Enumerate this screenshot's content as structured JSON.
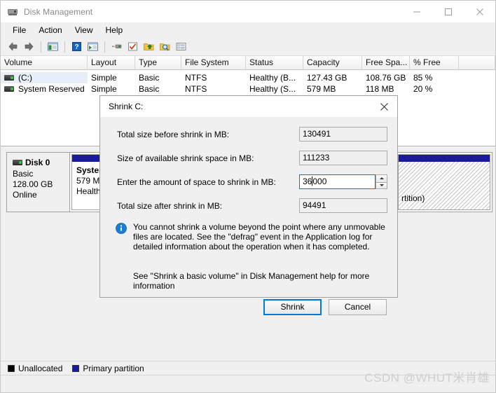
{
  "window": {
    "title": "Disk Management",
    "icon": "disk-drive-icon",
    "controls": {
      "minimize": "minimize-icon",
      "maximize": "maximize-icon",
      "close": "close-icon"
    }
  },
  "menu": {
    "items": [
      {
        "label": "File"
      },
      {
        "label": "Action"
      },
      {
        "label": "View"
      },
      {
        "label": "Help"
      }
    ]
  },
  "toolbar": {
    "buttons": [
      {
        "name": "back-arrow-icon"
      },
      {
        "name": "forward-arrow-icon"
      },
      {
        "name": "show-hide-console-tree-icon"
      },
      {
        "name": "help-question-icon"
      },
      {
        "name": "show-hide-action-pane-icon"
      },
      {
        "name": "properties-icon"
      },
      {
        "name": "rescan-disks-icon"
      },
      {
        "name": "export-list-icon"
      },
      {
        "name": "find-icon"
      },
      {
        "name": "details-view-icon"
      }
    ]
  },
  "volume_list": {
    "columns": [
      {
        "label": "Volume",
        "width": 124
      },
      {
        "label": "Layout",
        "width": 68
      },
      {
        "label": "Type",
        "width": 66
      },
      {
        "label": "File System",
        "width": 92
      },
      {
        "label": "Status",
        "width": 82
      },
      {
        "label": "Capacity",
        "width": 84
      },
      {
        "label": "Free Spa...",
        "width": 68
      },
      {
        "label": "% Free",
        "width": 70
      },
      {
        "label": "",
        "width": 54
      }
    ],
    "rows": [
      {
        "selected": true,
        "icon": "volume-drive-icon",
        "volume": "(C:)",
        "layout": "Simple",
        "type": "Basic",
        "file_system": "NTFS",
        "status": "Healthy (B...",
        "capacity": "127.43 GB",
        "free_space": "108.76 GB",
        "percent_free": "85 %"
      },
      {
        "selected": false,
        "icon": "volume-drive-icon",
        "volume": "System Reserved",
        "layout": "Simple",
        "type": "Basic",
        "file_system": "NTFS",
        "status": "Healthy (S...",
        "capacity": "579 MB",
        "free_space": "118 MB",
        "percent_free": "20 %"
      }
    ]
  },
  "disk_pane": {
    "disk": {
      "icon": "disk-drive-icon",
      "name": "Disk 0",
      "type": "Basic",
      "size": "128.00 GB",
      "status": "Online"
    },
    "partitions": [
      {
        "name_line": "System",
        "size_line": "579 MB",
        "status_line": "Healthy",
        "kind": "primary"
      },
      {
        "name_line": "",
        "size_line": "",
        "status_line": "",
        "kind": "primary"
      },
      {
        "name_line": "rtition)",
        "size_line": "",
        "status_line": "",
        "kind": "unallocated"
      }
    ]
  },
  "legend": {
    "items": [
      {
        "label": "Unallocated",
        "color": "#000000"
      },
      {
        "label": "Primary partition",
        "color": "#1a1a9c"
      }
    ]
  },
  "watermark": {
    "text": "CSDN @WHUT米肖雄"
  },
  "dialog": {
    "title": "Shrink C:",
    "close_icon": "close-icon",
    "fields": [
      {
        "label": "Total size before shrink in MB:",
        "value": "130491",
        "editable": false,
        "name": "total-size-before-shrink-field"
      },
      {
        "label": "Size of available shrink space in MB:",
        "value": "111233",
        "editable": false,
        "name": "available-shrink-space-field"
      },
      {
        "label": "Enter the amount of space to shrink in MB:",
        "value_before_caret": "36",
        "value_after_caret": "000",
        "value": "36000",
        "editable": true,
        "name": "shrink-amount-input"
      },
      {
        "label": "Total size after shrink in MB:",
        "value": "94491",
        "editable": false,
        "name": "total-size-after-shrink-field"
      }
    ],
    "info": {
      "icon": "information-icon",
      "text": "You cannot shrink a volume beyond the point where any unmovable files are located. See the \"defrag\" event in the Application log for detailed information about the operation when it has completed."
    },
    "help_text": "See \"Shrink a basic volume\" in Disk Management help for more information",
    "buttons": {
      "primary": "Shrink",
      "secondary": "Cancel"
    }
  },
  "colors": {
    "accent": "#0078d7",
    "primary_partition": "#1a1a9c",
    "unallocated": "#000000",
    "window_bg": "#f0f0f0"
  }
}
